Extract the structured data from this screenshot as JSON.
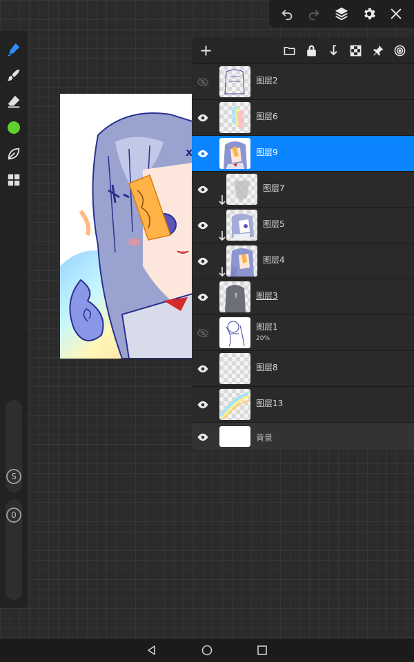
{
  "top_bar": {
    "icons": [
      "undo-icon",
      "redo-icon",
      "layers-icon",
      "settings-icon",
      "close-icon"
    ]
  },
  "tools": {
    "items": [
      "pen-icon",
      "smudge-icon",
      "eraser-icon",
      "color-swatch",
      "leaf-icon",
      "grid-icon"
    ],
    "current_color": "#5ed12c",
    "size_slider_label": "S",
    "opacity_slider_label": "0"
  },
  "layers_panel": {
    "toolbar_icons": [
      "add-icon",
      "folder-icon",
      "lock-icon",
      "merge-down-icon",
      "transparency-icon",
      "pin-icon",
      "spiral-icon"
    ],
    "layers": [
      {
        "name": "图层2",
        "visible": false,
        "clipped": false,
        "selected": false
      },
      {
        "name": "图层6",
        "visible": true,
        "clipped": false,
        "selected": false
      },
      {
        "name": "图层9",
        "visible": true,
        "clipped": false,
        "selected": true
      },
      {
        "name": "图层7",
        "visible": true,
        "clipped": true,
        "selected": false
      },
      {
        "name": "图层5",
        "visible": true,
        "clipped": true,
        "selected": false
      },
      {
        "name": "图层4",
        "visible": true,
        "clipped": true,
        "selected": false
      },
      {
        "name": "图层3",
        "visible": true,
        "clipped": false,
        "selected": false
      },
      {
        "name": "图层1",
        "opacity": "20%",
        "visible": false,
        "clipped": false,
        "selected": false
      },
      {
        "name": "图层8",
        "visible": true,
        "clipped": false,
        "selected": false
      },
      {
        "name": "图层13",
        "visible": true,
        "clipped": false,
        "selected": false
      }
    ],
    "background": {
      "name": "背景",
      "visible": true
    }
  },
  "colors": {
    "accent": "#0a84ff",
    "panel": "#262626",
    "canvas_bg": "#2b2b2b"
  },
  "nav_bar": {
    "icons": [
      "back-icon",
      "home-icon",
      "recents-icon"
    ]
  }
}
